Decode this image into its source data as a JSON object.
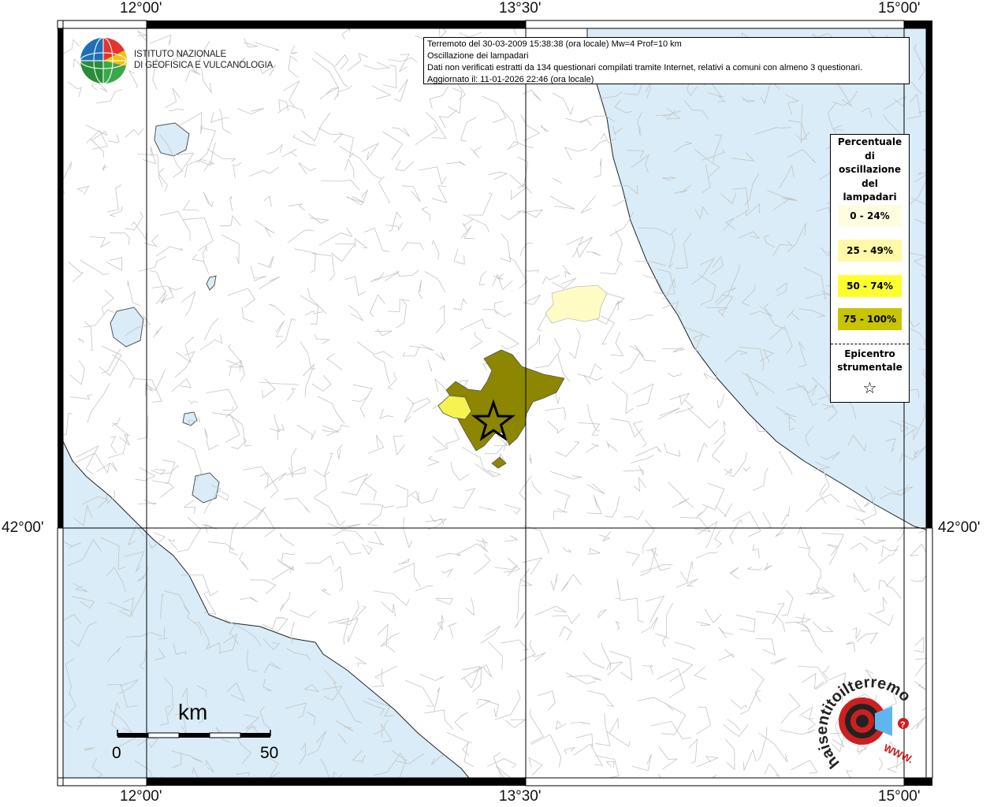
{
  "info_box": {
    "line1": "Terremoto del 30-03-2009 15:38:38 (ora locale) Mw=4 Prof=10 km",
    "line2": "Oscillazione dei lampadari",
    "line3": "Dati non verificati estratti da 134 questionari compilati tramite Internet, relativi a comuni con almeno 3 questionari.",
    "line4": "Aggiornato il: 11-01-2026 22:46 (ora locale)"
  },
  "coordinates": {
    "lon1": "12°00'",
    "lon2": "13°30'",
    "lon3": "15°00'",
    "lat1": "42°00'"
  },
  "legend": {
    "title_lines": [
      "Percentuale",
      "di",
      "oscillazione",
      "del",
      "lampadari"
    ],
    "items": [
      {
        "label": "0 - 24%",
        "color": "#fffde0"
      },
      {
        "label": "25 - 49%",
        "color": "#fff9a8"
      },
      {
        "label": "50 - 74%",
        "color": "#ffff2e"
      },
      {
        "label": "75 - 100%",
        "color": "#c8c400"
      }
    ],
    "epicenter_lines": [
      "Epicentro",
      "strumentale"
    ],
    "star": "☆"
  },
  "scale": {
    "unit": "km",
    "min": "0",
    "max": "50"
  },
  "logo_ingv": {
    "line1": "ISTITUTO NAZIONALE",
    "line2": "DI GEOFISICA E VULCANOLOGIA"
  },
  "logo_hsit": {
    "text": "haisentitoilterremoto.it",
    "www": "WWW.",
    "q": "?"
  },
  "colors": {
    "sea": "#d9ecf7",
    "land": "#ffffff",
    "border_line": "#bdbdbd",
    "intensity_high": "#8c8600",
    "intensity_mid": "#f5f251",
    "intensity_low": "#fffbc4"
  }
}
